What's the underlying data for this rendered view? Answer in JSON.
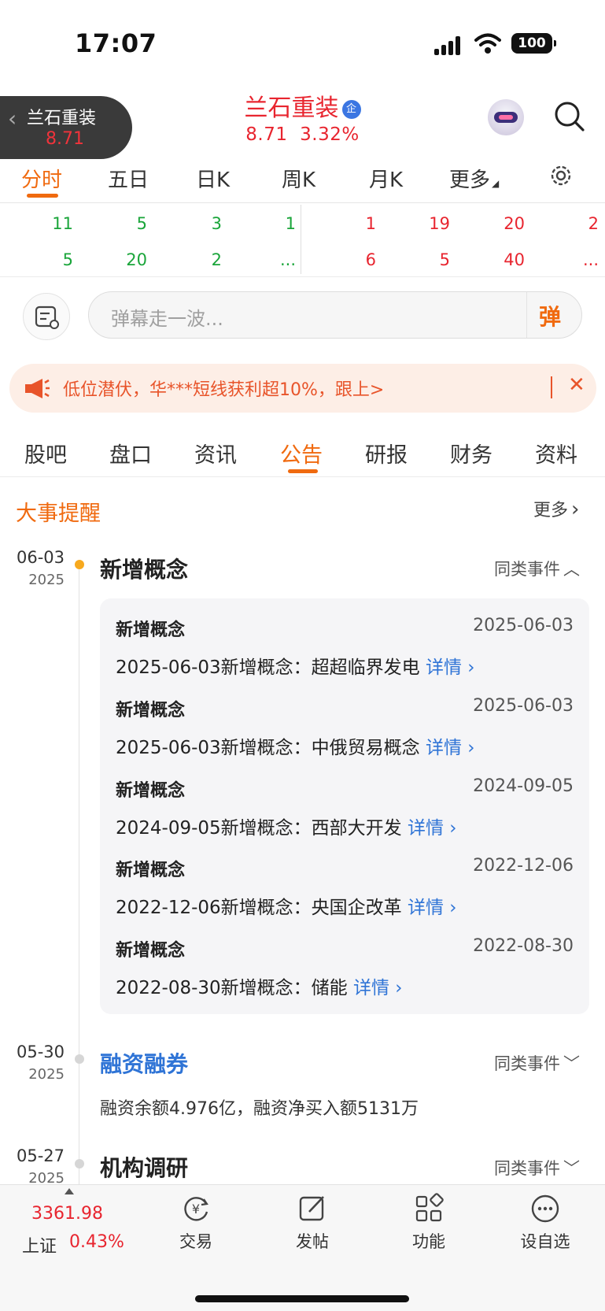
{
  "status": {
    "time": "17:07",
    "battery": "100"
  },
  "back_pill": {
    "name": "兰石重装",
    "price": "8.71"
  },
  "stock": {
    "name": "兰石重装",
    "badge": "企",
    "price": "8.71",
    "change_pct": "3.32%"
  },
  "chart_tabs": [
    "分时",
    "五日",
    "日K",
    "周K",
    "月K",
    "更多"
  ],
  "chart_tab_active": "分时",
  "order_board": {
    "left_row1": [
      "11",
      "5",
      "3",
      "1"
    ],
    "left_row2": [
      "5",
      "20",
      "2",
      "..."
    ],
    "right_row1": [
      "1",
      "19",
      "20",
      "2"
    ],
    "right_row2": [
      "6",
      "5",
      "40",
      "..."
    ]
  },
  "danmu": {
    "placeholder": "弹幕走一波...",
    "send_label": "弹"
  },
  "promo": {
    "text": "低位潜伏，华***短线获利超10%，跟上>"
  },
  "tabs": [
    "股吧",
    "盘口",
    "资讯",
    "公告",
    "研报",
    "财务",
    "资料"
  ],
  "tab_active": "公告",
  "section": {
    "title": "大事提醒",
    "more": "更多"
  },
  "events": [
    {
      "date_md": "06-03",
      "year": "2025",
      "title": "新增概念",
      "similar": "同类事件",
      "items": [
        {
          "category": "新增概念",
          "date": "2025-06-03",
          "desc": "2025-06-03新增概念：超超临界发电",
          "link": "详情"
        },
        {
          "category": "新增概念",
          "date": "2025-06-03",
          "desc": "2025-06-03新增概念：中俄贸易概念",
          "link": "详情"
        },
        {
          "category": "新增概念",
          "date": "2024-09-05",
          "desc": "2024-09-05新增概念：西部大开发",
          "link": "详情"
        },
        {
          "category": "新增概念",
          "date": "2022-12-06",
          "desc": "2022-12-06新增概念：央国企改革",
          "link": "详情"
        },
        {
          "category": "新增概念",
          "date": "2022-08-30",
          "desc": "2022-08-30新增概念：储能",
          "link": "详情"
        }
      ]
    },
    {
      "date_md": "05-30",
      "year": "2025",
      "title": "融资融券",
      "similar": "同类事件",
      "body": "融资余额4.976亿，融资净买入额5131万"
    },
    {
      "date_md": "05-27",
      "year": "2025",
      "title": "机构调研",
      "similar": "同类事件"
    }
  ],
  "bottom": {
    "index_value": "3361.98",
    "index_name": "上证",
    "index_change": "0.43%",
    "items": [
      "交易",
      "发帖",
      "功能",
      "设自选"
    ]
  },
  "colors": {
    "up": "#e8252f",
    "down": "#1aa53a",
    "accent": "#f06a0f",
    "link": "#2f74d6"
  }
}
